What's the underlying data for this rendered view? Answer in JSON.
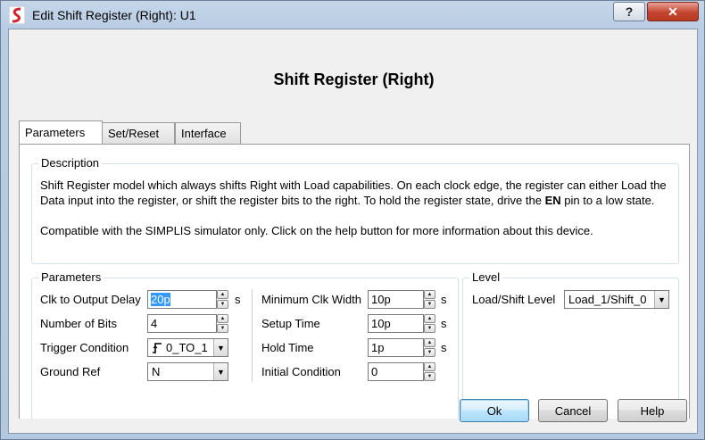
{
  "window": {
    "title": "Edit Shift Register (Right): U1",
    "help_button": "?",
    "close_button": "✕"
  },
  "heading": "Shift Register (Right)",
  "tabs": [
    {
      "label": "Parameters",
      "active": true
    },
    {
      "label": "Set/Reset",
      "active": false
    },
    {
      "label": "Interface",
      "active": false
    }
  ],
  "description": {
    "title": "Description",
    "line1_pre": "Shift Register model which always shifts Right with Load capabilities. On each clock edge, the register can either Load the Data input into the register, or shift the register bits to the right. To hold the register state, drive the ",
    "line1_bold": "EN",
    "line1_post": " pin to a low state.",
    "line2": "Compatible with the SIMPLIS simulator only. Click on the help button for more information about this device."
  },
  "parameters": {
    "title": "Parameters",
    "clk_to_output_delay": {
      "label": "Clk to Output Delay",
      "value": "20p",
      "unit": "s"
    },
    "number_of_bits": {
      "label": "Number of Bits",
      "value": "4"
    },
    "trigger_condition": {
      "label": "Trigger Condition",
      "value": "0_TO_1",
      "icon": "rising-edge-icon"
    },
    "ground_ref": {
      "label": "Ground Ref",
      "value": "N"
    },
    "minimum_clk_width": {
      "label": "Minimum Clk Width",
      "value": "10p",
      "unit": "s"
    },
    "setup_time": {
      "label": "Setup Time",
      "value": "10p",
      "unit": "s"
    },
    "hold_time": {
      "label": "Hold Time",
      "value": "1p",
      "unit": "s"
    },
    "initial_condition": {
      "label": "Initial Condition",
      "value": "0"
    }
  },
  "level": {
    "title": "Level",
    "load_shift_level": {
      "label": "Load/Shift Level",
      "value": "Load_1/Shift_0"
    }
  },
  "buttons": {
    "ok": "Ok",
    "cancel": "Cancel",
    "help": "Help"
  },
  "colors": {
    "titlebar": "#b9cde4",
    "close": "#c4452f",
    "selection": "#3399ff",
    "app_icon": "#d2232a"
  }
}
